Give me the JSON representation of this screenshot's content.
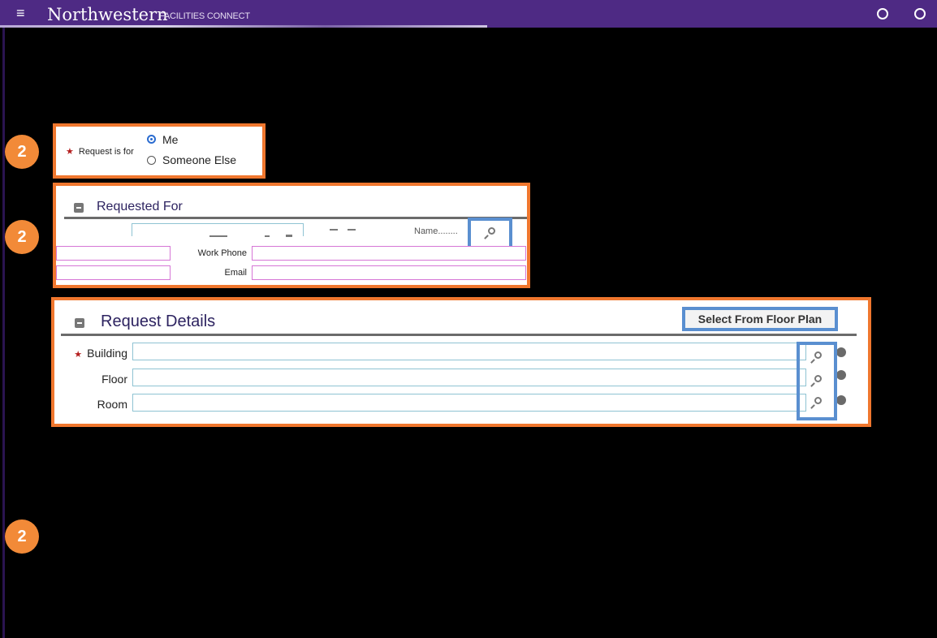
{
  "header": {
    "menu_glyph": "≡",
    "brand": "Northwestern",
    "app_name": "FACILITIES CONNECT",
    "icons": [
      "info-icon",
      "help-icon"
    ],
    "color": "#4e2a84"
  },
  "step_badges": [
    "2",
    "2",
    "2"
  ],
  "request_for": {
    "label": "Request is for",
    "options": [
      "Me",
      "Someone Else"
    ],
    "selected": "Me"
  },
  "requested_for": {
    "title": "Requested For",
    "name_label": "Name........",
    "work_phone_label": "Work Phone",
    "email_label": "Email"
  },
  "request_details": {
    "title": "Request Details",
    "floor_plan_button": "Select From Floor Plan",
    "fields": [
      {
        "label": "Building",
        "required": true
      },
      {
        "label": "Floor",
        "required": false
      },
      {
        "label": "Room",
        "required": false
      }
    ]
  },
  "colors": {
    "highlight_orange": "#f0772e",
    "highlight_blue": "#5a8fd0",
    "badge": "#f28a38"
  }
}
